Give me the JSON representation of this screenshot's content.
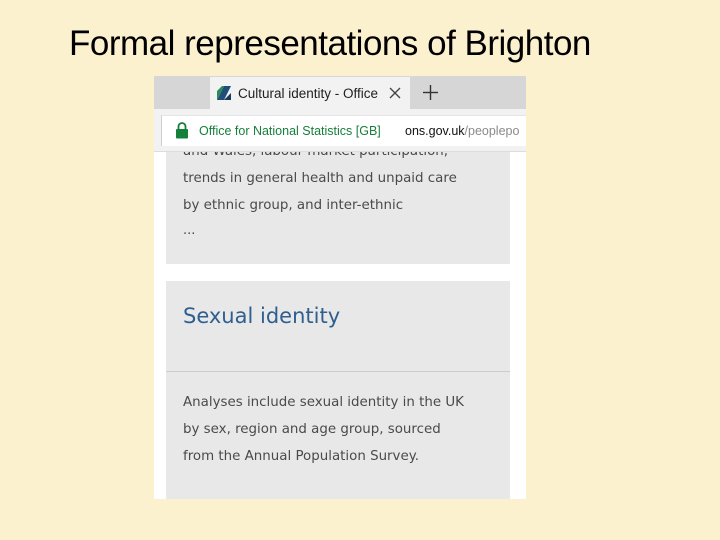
{
  "slide": {
    "title": "Formal representations of Brighton"
  },
  "browser": {
    "tab": {
      "title": "Cultural identity - Office",
      "favicon": "ons-logo-icon"
    },
    "icons": {
      "close": "close-icon",
      "new_tab": "plus-icon",
      "lock": "lock-icon"
    },
    "address_bar": {
      "certificate_label": "Office for National Statistics [GB]",
      "host": "ons.gov.uk",
      "path": "/peoplepo"
    },
    "colors": {
      "secure": "#167f3a",
      "link_heading": "#2e5f8f"
    }
  },
  "page": {
    "cards": [
      {
        "lines": [
          "and Wales, labour market participation,",
          "trends in general health and unpaid care",
          "by ethnic group, and inter-ethnic"
        ],
        "ellipsis": "..."
      },
      {
        "heading": "Sexual identity",
        "lines": [
          "Analyses include sexual identity in the UK",
          "by sex, region and age group, sourced",
          "from the Annual Population Survey."
        ]
      }
    ]
  }
}
